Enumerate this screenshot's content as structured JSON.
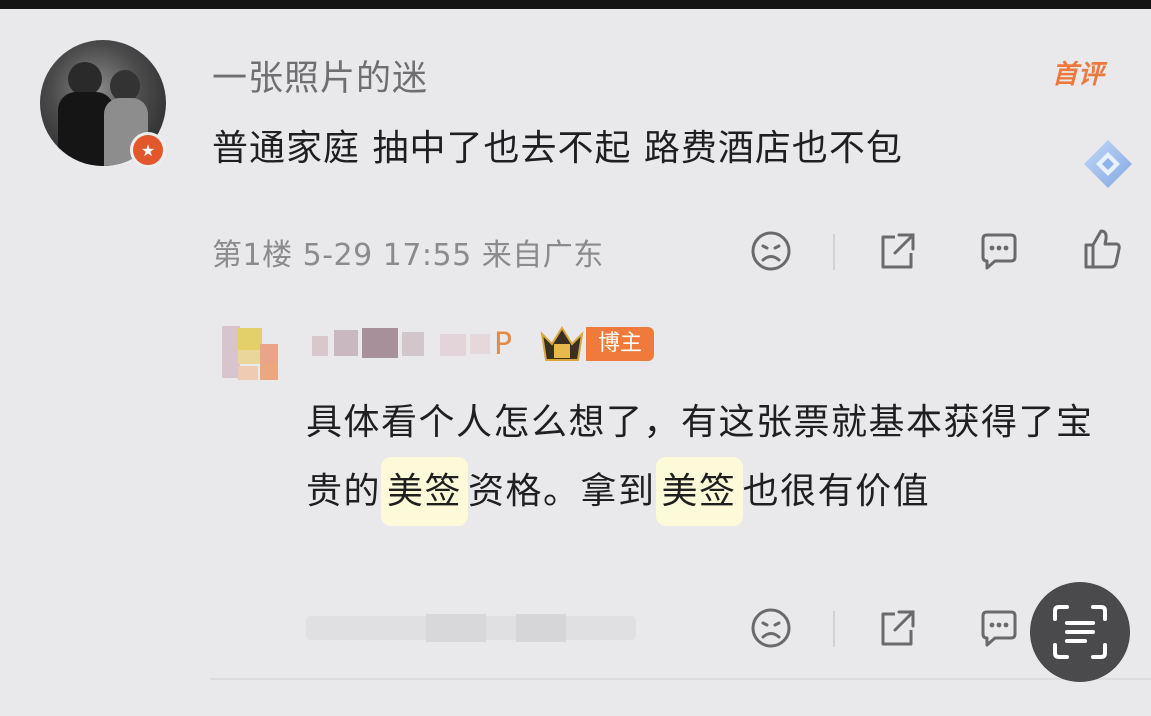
{
  "comment": {
    "username": "一张照片的迷",
    "badge": "首评",
    "text": "普通家庭 抽中了也去不起 路费酒店也不包",
    "meta": "第1楼 5-29 17:55 来自广东"
  },
  "reply": {
    "role_badge": "博主",
    "text_parts": [
      "具体看个人怎么想了，有这张票就基本获得了宝贵的",
      "美签",
      "资格。拿到",
      "美签",
      "也很有价值"
    ]
  },
  "icons": {
    "dislike": "sad-face-icon",
    "share": "share-icon",
    "comment": "comment-icon",
    "like": "thumbs-up-icon",
    "scan": "scan-text-icon",
    "vip": "v-badge-icon",
    "crown": "crown-icon"
  },
  "colors": {
    "accent_orange": "#ec7a3e",
    "highlight": "#fdfad9"
  }
}
